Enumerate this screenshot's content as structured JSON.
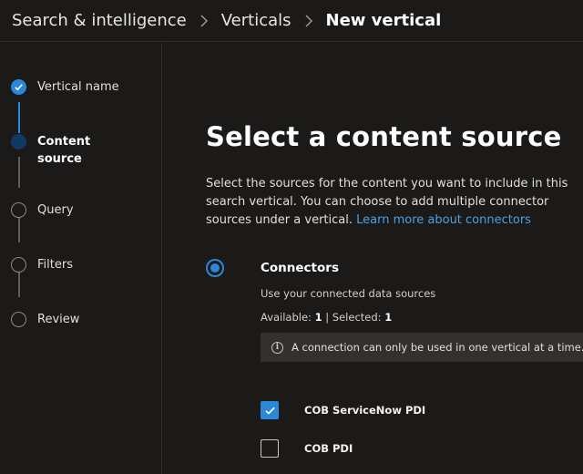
{
  "breadcrumb": {
    "items": [
      "Search & intelligence",
      "Verticals",
      "New vertical"
    ]
  },
  "stepper": {
    "steps": [
      {
        "label": "Vertical name",
        "state": "completed"
      },
      {
        "label": "Content source",
        "state": "current"
      },
      {
        "label": "Query",
        "state": "pending"
      },
      {
        "label": "Filters",
        "state": "pending"
      },
      {
        "label": "Review",
        "state": "pending"
      }
    ]
  },
  "main": {
    "title": "Select a content source",
    "description": "Select the sources for the content you want to include in this search vertical. You can choose to add multiple connector sources under a vertical.",
    "learn_more": "Learn more about connectors",
    "connectors": {
      "radio_selected": true,
      "title": "Connectors",
      "subtitle": "Use your connected data sources",
      "available_label": "Available:",
      "available_count": "1",
      "separator": "|",
      "selected_label": "Selected:",
      "selected_count": "1",
      "info_message": "A connection can only be used in one vertical at a time.",
      "items": [
        {
          "label": "COB ServiceNow PDI",
          "checked": true
        },
        {
          "label": "COB PDI",
          "checked": false
        }
      ]
    }
  },
  "colors": {
    "accent": "#2b88d8",
    "link": "#4aa0e6",
    "background": "#1b1a19",
    "info_bar": "#323130"
  }
}
